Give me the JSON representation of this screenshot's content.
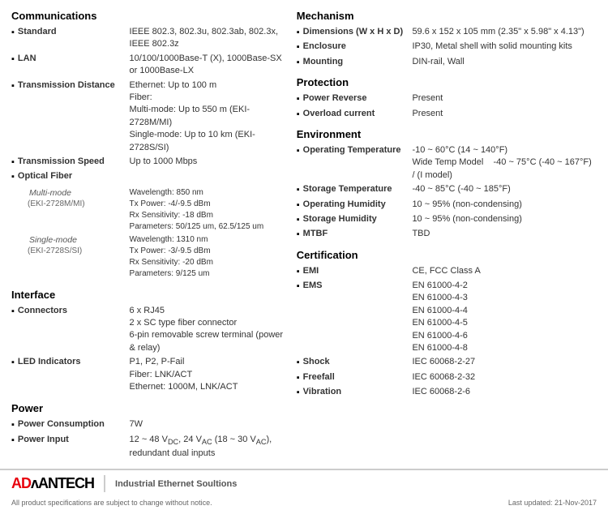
{
  "left": {
    "sections": [
      {
        "title": "Communications",
        "rows": [
          {
            "label": "Standard",
            "bold": true,
            "bullet": true,
            "value": "IEEE 802.3, 802.3u, 802.3ab, 802.3x, IEEE 802.3z"
          },
          {
            "label": "LAN",
            "bold": true,
            "bullet": true,
            "value": "10/100/1000Base-T (X), 1000Base-SX or 1000Base-LX"
          },
          {
            "label": "Transmission Distance",
            "bold": true,
            "bullet": true,
            "value_lines": [
              "Ethernet: Up to 100 m",
              "Fiber:",
              "Multi-mode: Up to 550 m (EKI-2728M/MI)",
              "Single-mode: Up to 10 km (EKI-2728S/SI)"
            ]
          },
          {
            "label": "Transmission Speed",
            "bold": true,
            "bullet": true,
            "value": "Up to 1000 Mbps"
          },
          {
            "label": "Optical Fiber",
            "bold": true,
            "bullet": true,
            "value": ""
          }
        ],
        "optical_fiber": {
          "multimode_label": "Multi-mode",
          "multimode_eki": "(EKI-2728M/MI)",
          "multimode_lines": [
            "Wavelength: 850 nm",
            "Tx Power: -4/-9.5 dBm",
            "Rx Sensitivity: -18 dBm",
            "Parameters: 50/125 um, 62.5/125 um"
          ],
          "singlemode_label": "Single-mode",
          "singlemode_eki": "(EKI-2728S/SI)",
          "singlemode_lines": [
            "Wavelength: 1310 nm",
            "Tx Power: -3/-9.5 dBm",
            "Rx Sensitivity: -20 dBm",
            "Parameters: 9/125 um"
          ]
        }
      },
      {
        "title": "Interface",
        "rows": [
          {
            "label": "Connectors",
            "bold": true,
            "bullet": true,
            "value_lines": [
              "6 x RJ45",
              "2 x SC type fiber connector",
              "6-pin removable screw terminal (power & relay)"
            ]
          },
          {
            "label": "LED Indicators",
            "bold": true,
            "bullet": true,
            "value_lines": [
              "P1, P2, P-Fail",
              "Fiber: LNK/ACT",
              "Ethernet: 1000M, LNK/ACT"
            ]
          }
        ]
      },
      {
        "title": "Power",
        "rows": [
          {
            "label": "Power Consumption",
            "bold": true,
            "bullet": true,
            "value": "7W"
          },
          {
            "label": "Power Input",
            "bold": true,
            "bullet": true,
            "value": "12 ~ 48 VᴅC, 24 VAC (18 ~ 30 VAC), redundant dual inputs"
          }
        ]
      }
    ]
  },
  "right": {
    "sections": [
      {
        "title": "Mechanism",
        "rows": [
          {
            "label": "Dimensions (W x H x D)",
            "bold": true,
            "bullet": true,
            "value": "59.6 x 152 x 105 mm (2.35\" x 5.98\" x 4.13\")"
          },
          {
            "label": "Enclosure",
            "bold": true,
            "bullet": true,
            "value": "IP30, Metal shell with solid mounting kits"
          },
          {
            "label": "Mounting",
            "bold": true,
            "bullet": true,
            "value": "DIN-rail, Wall"
          }
        ]
      },
      {
        "title": "Protection",
        "rows": [
          {
            "label": "Power Reverse",
            "bold": true,
            "bullet": true,
            "value": "Present"
          },
          {
            "label": "Overload current",
            "bold": true,
            "bullet": true,
            "value": "Present"
          }
        ]
      },
      {
        "title": "Environment",
        "rows": [
          {
            "label": "Operating Temperature",
            "bold": true,
            "bullet": true,
            "value_lines": [
              "-10 ~ 60°C (14 ~ 140°F)",
              "Wide Temp Model       -40 ~ 75°C (-40 ~ 167°F) / (I model)"
            ]
          },
          {
            "label": "Storage Temperature",
            "bold": true,
            "bullet": true,
            "value": "-40 ~ 85°C (-40 ~ 185°F)"
          },
          {
            "label": "Operating Humidity",
            "bold": true,
            "bullet": true,
            "value": "10 ~ 95% (non-condensing)"
          },
          {
            "label": "Storage Humidity",
            "bold": true,
            "bullet": true,
            "value": "10 ~ 95% (non-condensing)"
          },
          {
            "label": "MTBF",
            "bold": true,
            "bullet": true,
            "value": "TBD"
          }
        ]
      },
      {
        "title": "Certification",
        "rows": [
          {
            "label": "EMI",
            "bold": true,
            "bullet": true,
            "value": "CE, FCC Class A"
          },
          {
            "label": "EMS",
            "bold": true,
            "bullet": true,
            "value_lines": [
              "EN 61000-4-2",
              "EN 61000-4-3",
              "EN 61000-4-4",
              "EN 61000-4-5",
              "EN 61000-4-6",
              "EN 61000-4-8"
            ]
          },
          {
            "label": "Shock",
            "bold": true,
            "bullet": true,
            "value": "IEC 60068-2-27"
          },
          {
            "label": "Freefall",
            "bold": true,
            "bullet": true,
            "value": "IEC 60068-2-32"
          },
          {
            "label": "Vibration",
            "bold": true,
            "bullet": true,
            "value": "IEC 60068-2-6"
          }
        ]
      }
    ]
  },
  "footer": {
    "logo_ad": "AD",
    "logo_vantech": "ʟANTECH",
    "tagline": "Industrial Ethernet Soultions",
    "notice": "All product specifications are subject to change without notice.",
    "last_updated": "Last updated: 21-Nov-2017"
  }
}
